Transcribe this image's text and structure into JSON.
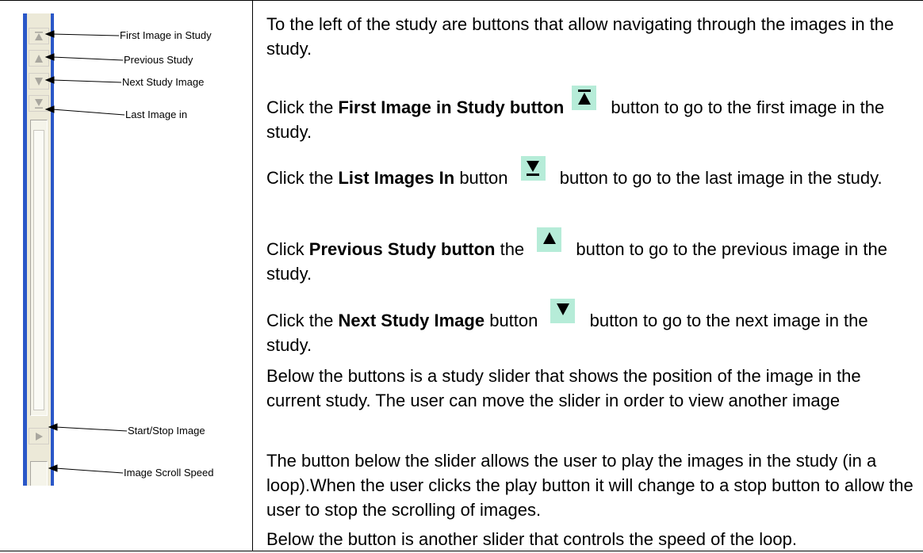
{
  "callouts": {
    "first_image": "First Image in Study",
    "previous_study": "Previous Study",
    "next_study_image": "Next Study Image",
    "last_image": "Last Image in",
    "start_stop": "Start/Stop Image",
    "scroll_speed": "Image Scroll Speed"
  },
  "paragraphs": {
    "intro": "To the left of the study are buttons that allow navigating through the images in the study.",
    "first": {
      "prefix": "Click the ",
      "bold": "First Image in Study button",
      "suffix": " button to go to the first image in the study."
    },
    "last": {
      "prefix": "Click the ",
      "bold": "List Images In",
      "middle": " button ",
      "suffix": " button to go to the last image in the study."
    },
    "previous": {
      "prefix": "Click ",
      "bold": "Previous Study button",
      "middle": " the ",
      "suffix": " button to go to the previous image in the study."
    },
    "next": {
      "prefix": "Click the ",
      "bold": "Next Study Image",
      "middle": " button ",
      "suffix": " button to go to the next image in the study."
    },
    "slider": "Below the buttons is a study slider that shows the position of the image in the current study. The user can move the slider in order to view another image",
    "play": "The button below the slider allows the user to play the images in the study (in a loop).When the user clicks the play button it will change to a stop button to allow the user to stop the scrolling of images.",
    "speed": "Below the button is another slider that controls the speed of the loop."
  },
  "icons": {
    "first": "first-image-icon",
    "last": "last-image-icon",
    "previous": "previous-icon",
    "next": "next-icon",
    "play": "play-icon"
  },
  "colors": {
    "toolbar_border": "#2a57c8",
    "icon_highlight": "#b6ecd8"
  }
}
